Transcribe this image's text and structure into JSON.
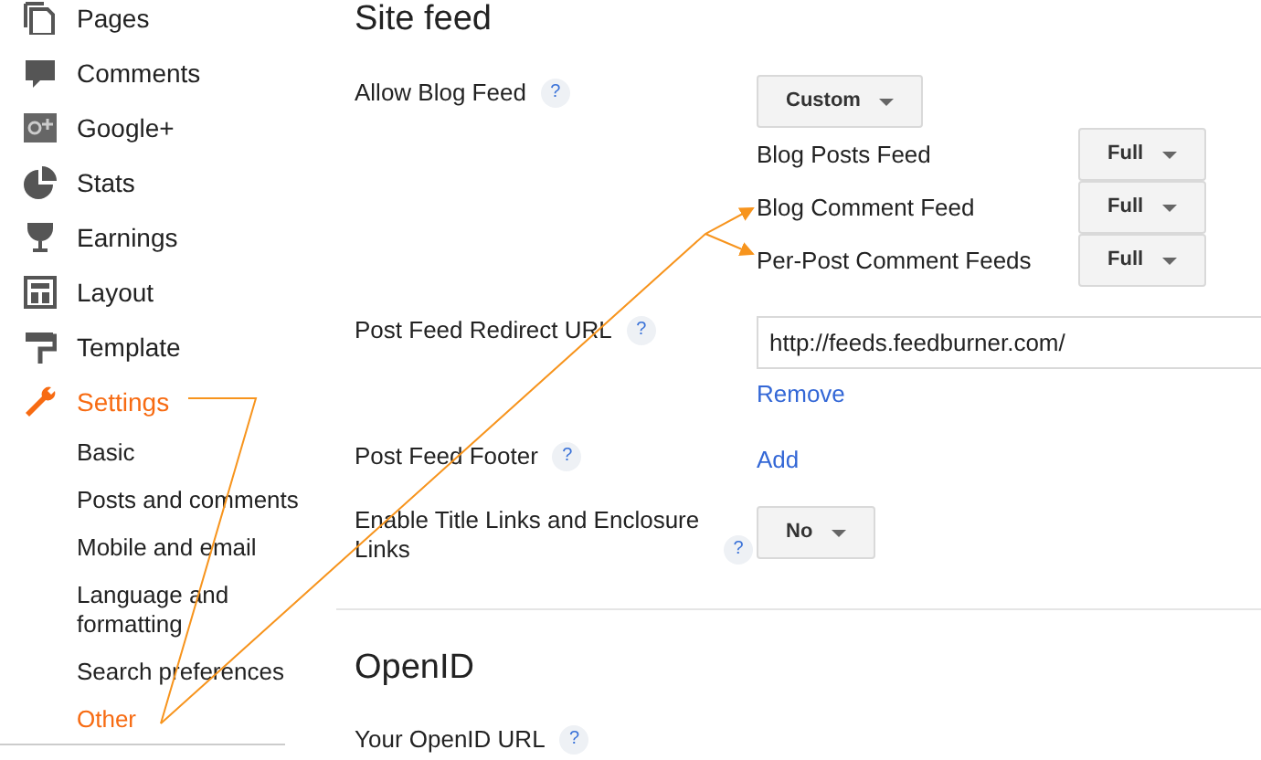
{
  "sidebar": {
    "items": [
      {
        "label": "Pages",
        "selected": false
      },
      {
        "label": "Comments",
        "selected": false
      },
      {
        "label": "Google+",
        "selected": false
      },
      {
        "label": "Stats",
        "selected": false
      },
      {
        "label": "Earnings",
        "selected": false
      },
      {
        "label": "Layout",
        "selected": false
      },
      {
        "label": "Template",
        "selected": false
      },
      {
        "label": "Settings",
        "selected": true,
        "children": [
          {
            "label": "Basic",
            "selected": false
          },
          {
            "label": "Posts and comments",
            "selected": false
          },
          {
            "label": "Mobile and email",
            "selected": false
          },
          {
            "label": "Language and formatting",
            "selected": false
          },
          {
            "label": "Search preferences",
            "selected": false
          },
          {
            "label": "Other",
            "selected": true
          }
        ]
      }
    ]
  },
  "sections": [
    {
      "title": "Site feed",
      "rows": [
        {
          "kind": "dropdown",
          "label": "Allow Blog Feed",
          "help": "?",
          "value": "Custom",
          "subrows": [
            {
              "label": "Blog Posts Feed",
              "value": "Full"
            },
            {
              "label": "Blog Comment Feed",
              "value": "Full"
            },
            {
              "label": "Per-Post Comment Feeds",
              "value": "Full"
            }
          ]
        },
        {
          "kind": "url",
          "label": "Post Feed Redirect URL",
          "help": "?",
          "value": "http://feeds.feedburner.com/",
          "link": "Remove"
        },
        {
          "kind": "link",
          "label": "Post Feed Footer",
          "help": "?",
          "link": "Add"
        },
        {
          "kind": "dropdown",
          "label": "Enable Title Links and Enclosure Links",
          "help": "?",
          "value": "No"
        }
      ]
    },
    {
      "title": "OpenID",
      "rows": [
        {
          "kind": "none",
          "label": "Your OpenID URL",
          "help": "?"
        }
      ]
    }
  ]
}
